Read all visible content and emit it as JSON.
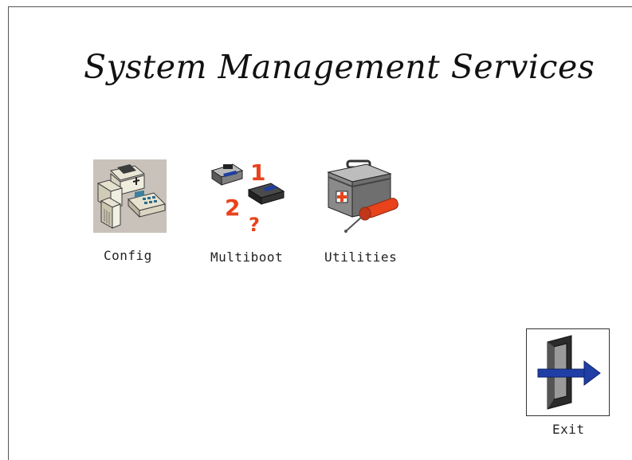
{
  "header": {
    "title": "System Management Services"
  },
  "menu": {
    "items": [
      {
        "label": "Config",
        "icon": "config-icon"
      },
      {
        "label": "Multiboot",
        "icon": "multiboot-icon"
      },
      {
        "label": "Utilities",
        "icon": "utilities-icon"
      }
    ]
  },
  "exit": {
    "label": "Exit",
    "icon": "exit-door-icon"
  },
  "colors": {
    "accent_red": "#e8431b",
    "arrow_blue": "#1f3fa6",
    "config_bg": "#c9c2bb"
  }
}
